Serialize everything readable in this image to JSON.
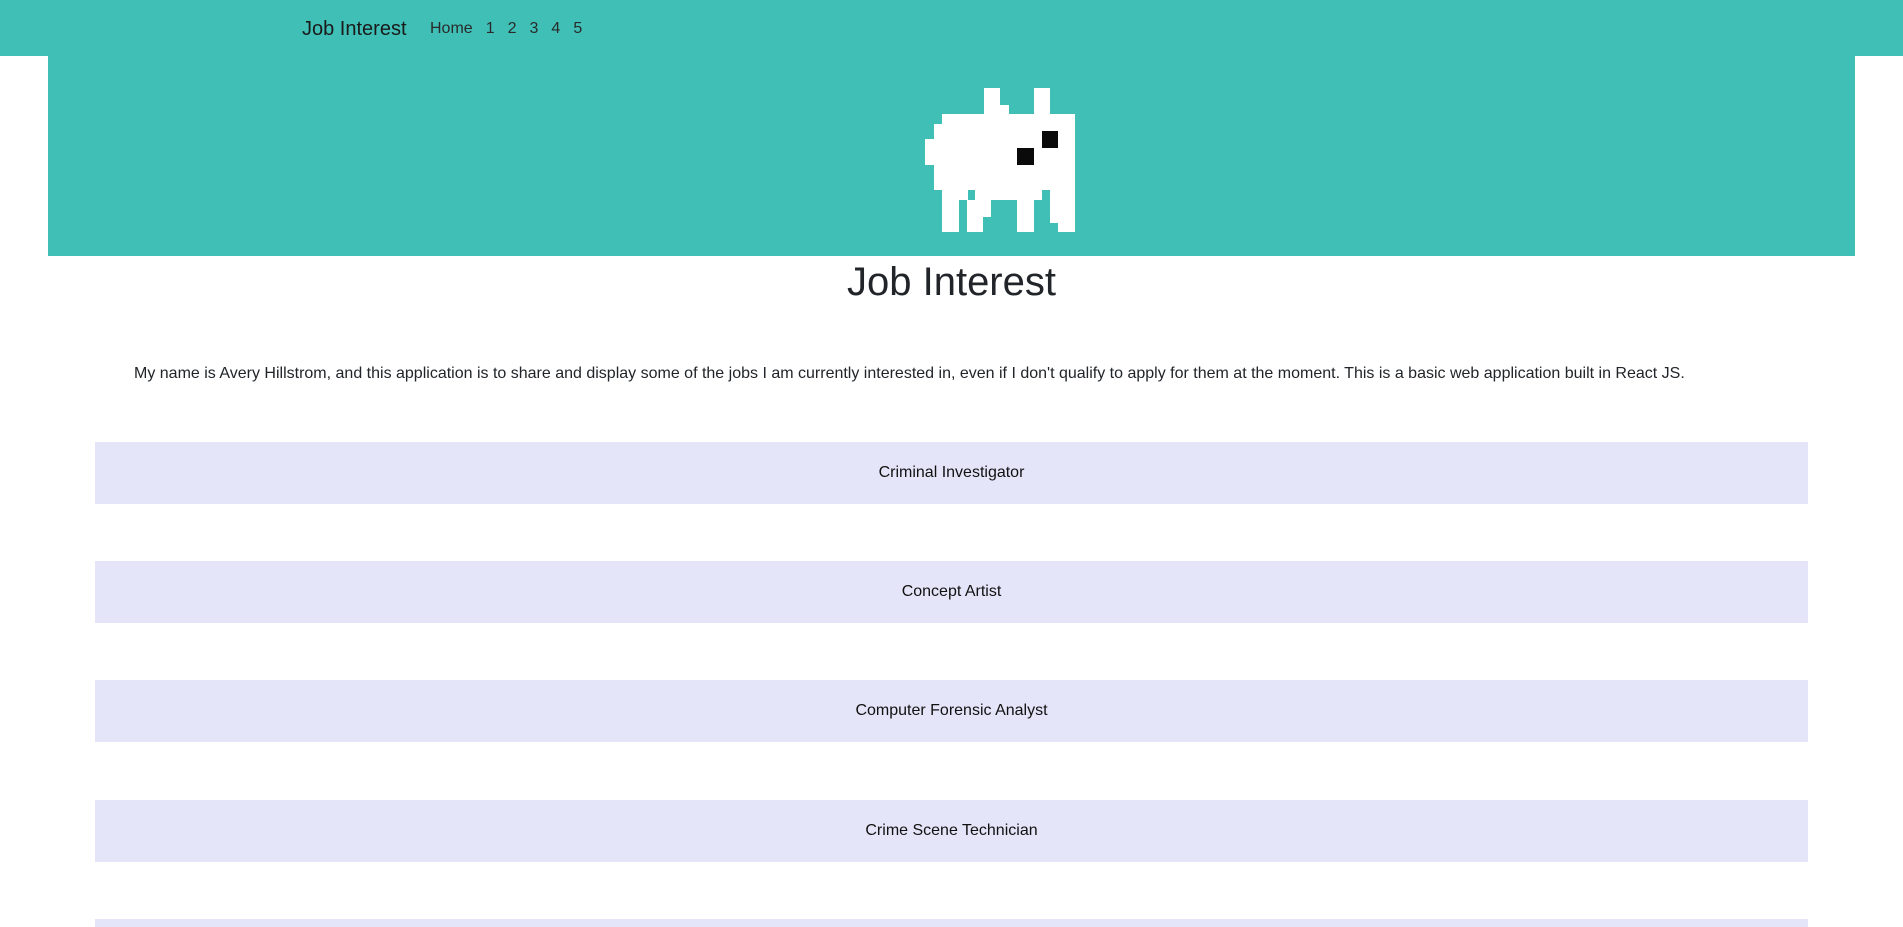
{
  "navbar": {
    "brand": "Job Interest",
    "links": [
      "Home",
      "1",
      "2",
      "3",
      "4",
      "5"
    ]
  },
  "hero": {
    "image": "pixel-creature-icon"
  },
  "page": {
    "title": "Job Interest",
    "intro": "My name is Avery Hillstrom, and this application is to share and display some of the jobs I am currently interested in, even if I don't qualify to apply for them at the moment. This is a basic web application built in React JS."
  },
  "jobs": [
    "Criminal Investigator",
    "Concept Artist",
    "Computer Forensic Analyst",
    "Crime Scene Technician",
    ""
  ],
  "colors": {
    "accent": "#3fbfb6",
    "card": "#e4e5f8"
  }
}
